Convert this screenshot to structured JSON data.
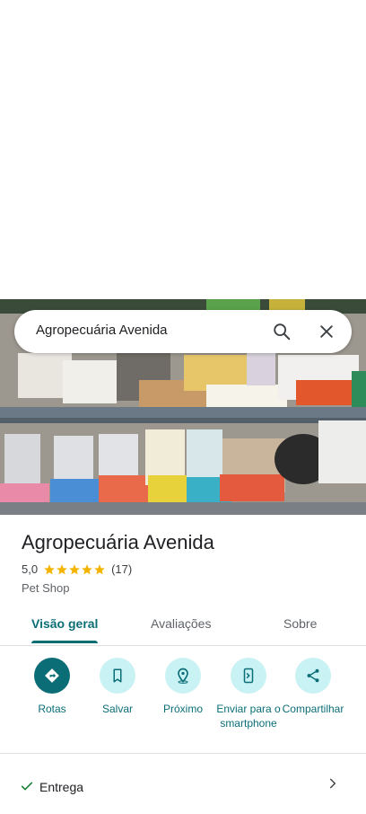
{
  "search": {
    "query": "Agropecuária Avenida"
  },
  "place": {
    "title": "Agropecuária Avenida",
    "rating": "5,0",
    "stars": 5,
    "review_count": "(17)",
    "category": "Pet Shop"
  },
  "tabs": [
    {
      "label": "Visão geral",
      "active": true
    },
    {
      "label": "Avaliações",
      "active": false
    },
    {
      "label": "Sobre",
      "active": false
    }
  ],
  "actions": [
    {
      "label": "Rotas",
      "icon": "directions-icon"
    },
    {
      "label": "Salvar",
      "icon": "bookmark-icon"
    },
    {
      "label": "Próximo",
      "icon": "nearby-icon"
    },
    {
      "label": "Enviar para o smartphone",
      "icon": "send-to-phone-icon"
    },
    {
      "label": "Compartilhar",
      "icon": "share-icon"
    }
  ],
  "delivery": {
    "label": "Entrega",
    "icon": "check-icon"
  },
  "colors": {
    "accent": "#0b6e77",
    "action_bg": "#c9f2f5",
    "star": "#f4b400"
  }
}
